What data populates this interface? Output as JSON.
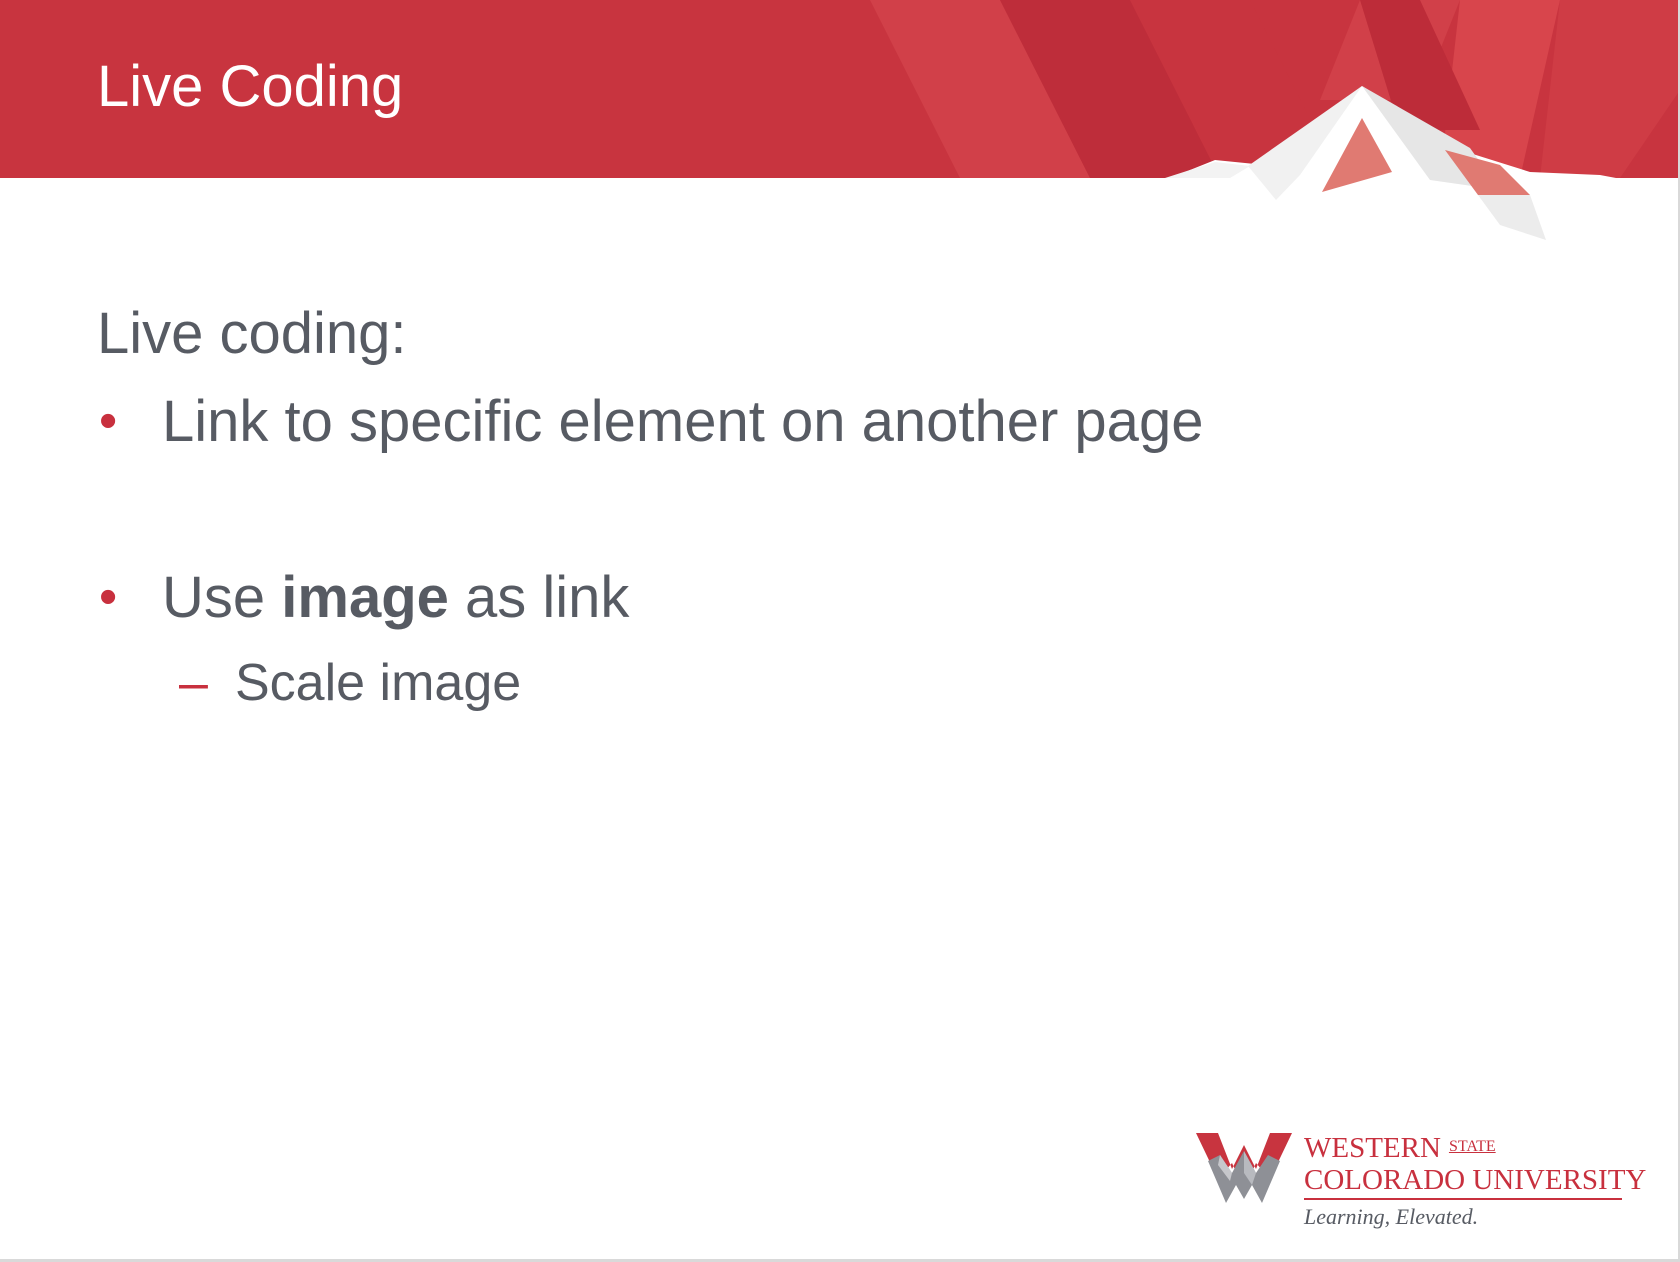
{
  "slide": {
    "title": "Live Coding",
    "intro": "Live coding:",
    "bullets": [
      {
        "text": "Link to specific element on another page"
      },
      {
        "text_before": "Use ",
        "text_bold": "image",
        "text_after": " as link"
      }
    ],
    "sub_bullets": [
      {
        "text": "Scale image"
      }
    ]
  },
  "logo": {
    "line1": "WESTERN",
    "state": "STATE",
    "line2": "COLORADO UNIVERSITY",
    "tagline": "Learning, Elevated."
  },
  "colors": {
    "brand_red": "#c8303e",
    "text_gray": "#575b63",
    "background": "#ffffff"
  },
  "icons": {
    "bullet": "red-dot",
    "sub_bullet": "red-dash"
  }
}
